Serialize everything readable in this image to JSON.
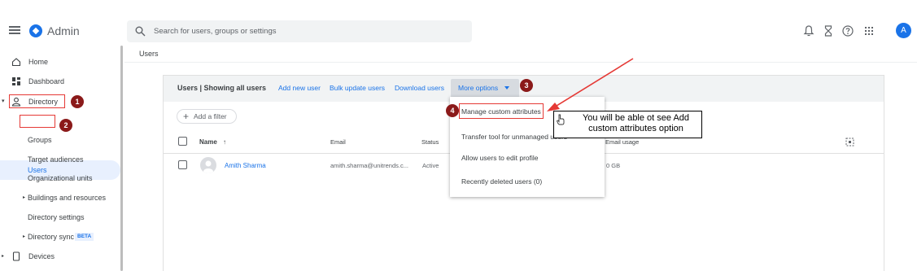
{
  "header": {
    "menu_icon": "hamburger-icon",
    "logo_icon": "admin-logo-icon",
    "app_title": "Admin",
    "search": {
      "placeholder": "Search for users, groups or settings",
      "icon": "search-icon"
    },
    "icons": [
      "bell-icon",
      "hourglass-icon",
      "help-icon",
      "apps-grid-icon"
    ],
    "avatar_letter": "A"
  },
  "sidebar": {
    "home": "Home",
    "dashboard": "Dashboard",
    "directory": "Directory",
    "users": "Users",
    "groups": "Groups",
    "target_audiences": "Target audiences",
    "org_units": "Organizational units",
    "buildings": "Buildings and resources",
    "directory_settings": "Directory settings",
    "directory_sync": "Directory sync",
    "directory_sync_badge": "BETA",
    "devices": "Devices"
  },
  "breadcrumb": "Users",
  "card": {
    "title": "Users | Showing all users",
    "actions": {
      "add_user": "Add new user",
      "bulk_update": "Bulk update users",
      "download": "Download users",
      "more_options": "More options"
    },
    "filter_label": "Add a filter",
    "columns": {
      "name": "Name",
      "email": "Email",
      "status": "Status",
      "email_usage": "Email usage"
    },
    "rows": [
      {
        "name": "Amith Sharma",
        "email": "amith.sharma@unitrends.c...",
        "status": "Active",
        "email_usage": "0 GB"
      }
    ]
  },
  "dropdown": {
    "items": [
      "Manage custom attributes",
      "Transfer tool for unmanaged users",
      "Allow users to edit profile",
      "Recently deleted users (0)"
    ]
  },
  "annotations": {
    "badges": [
      "1",
      "2",
      "3",
      "4"
    ],
    "callout": "You will be able ot see Add custom attributes option",
    "accent_color": "#e53935",
    "badge_color": "#8b1a1a"
  },
  "colors": {
    "primary": "#1a73e8",
    "selected_bg": "#e8f0fe",
    "card_header_bg": "#f1f3f4"
  }
}
